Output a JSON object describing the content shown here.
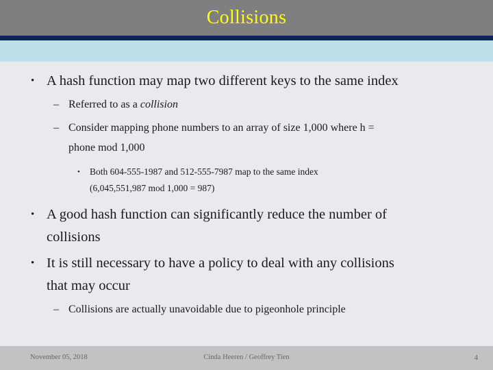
{
  "slide": {
    "title": "Collisions",
    "title_color": "#ffff00",
    "title_band_color": "#7f7f7f",
    "rule_color": "#0d2356",
    "accent_band_color": "#bfdfe9",
    "body_background": "#eaeaee",
    "footer_background": "#c2c2c2",
    "body_text_color": "#1a1a1a",
    "footer_text_color": "#666666"
  },
  "content": {
    "bullets": [
      {
        "level": 1,
        "marker": "•",
        "text": "A hash function may map two different keys to the same index"
      },
      {
        "level": 2,
        "marker": "–",
        "text_plain": "Referred to as a ",
        "text_italic": "collision"
      },
      {
        "level": 2,
        "marker": "–",
        "line1": "Consider mapping phone numbers to an array of size 1,000 where h =",
        "line2": "phone mod 1,000"
      },
      {
        "level": 3,
        "marker": "•",
        "line1": "Both 604-555-1987 and 512-555-7987 map to the same index",
        "line2": "(6,045,551,987 mod 1,000 = 987)"
      },
      {
        "level": 1,
        "marker": "•",
        "line1": "A good hash function can significantly reduce the number of",
        "line2": "collisions"
      },
      {
        "level": 1,
        "marker": "•",
        "line1": "It is still necessary to have a policy to deal with any collisions",
        "line2": "that may occur"
      },
      {
        "level": 2,
        "marker": "–",
        "text": "Collisions are actually unavoidable due to pigeonhole principle"
      }
    ]
  },
  "footer": {
    "date": "November 05, 2018",
    "authors": "Cinda Heeren / Geoffrey Tien",
    "page_number": "4"
  }
}
